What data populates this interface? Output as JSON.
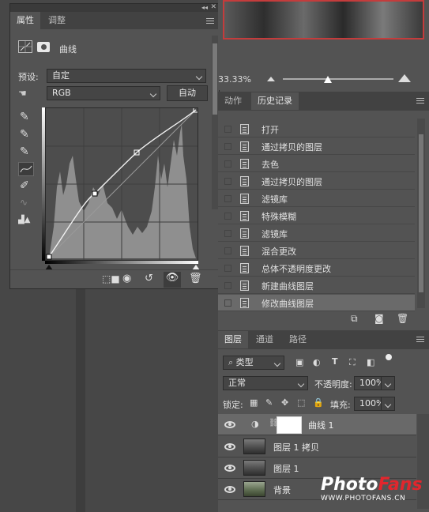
{
  "properties": {
    "tabs": [
      "属性",
      "调整"
    ],
    "title": "曲线",
    "preset_label": "预设:",
    "preset_value": "自定",
    "channel_value": "RGB",
    "auto_button": "自动"
  },
  "navigator": {
    "zoom": "33.33%"
  },
  "history": {
    "tabs": [
      "动作",
      "历史记录"
    ],
    "items": [
      "打开",
      "通过拷贝的图层",
      "去色",
      "通过拷贝的图层",
      "滤镜库",
      "特殊模糊",
      "滤镜库",
      "混合更改",
      "总体不透明度更改",
      "新建曲线图层",
      "修改曲线图层"
    ]
  },
  "layers": {
    "tabs": [
      "图层",
      "通道",
      "路径"
    ],
    "kind_filter": "类型",
    "blend_mode": "正常",
    "opacity_label": "不透明度:",
    "opacity_value": "100%",
    "lock_label": "锁定:",
    "fill_label": "填充:",
    "fill_value": "100%",
    "items": [
      "曲线 1",
      "图层 1 拷贝",
      "图层 1",
      "背景"
    ]
  },
  "watermark": {
    "brand_a": "Photo",
    "brand_b": "Fans",
    "url": "WWW.PHOTOFANS.CN"
  },
  "colors": {
    "panel": "#535353",
    "dark": "#424242",
    "selected_row": "#6a6a6a",
    "brand_red": "#e2262d",
    "canvas_border": "#c43c3c"
  }
}
